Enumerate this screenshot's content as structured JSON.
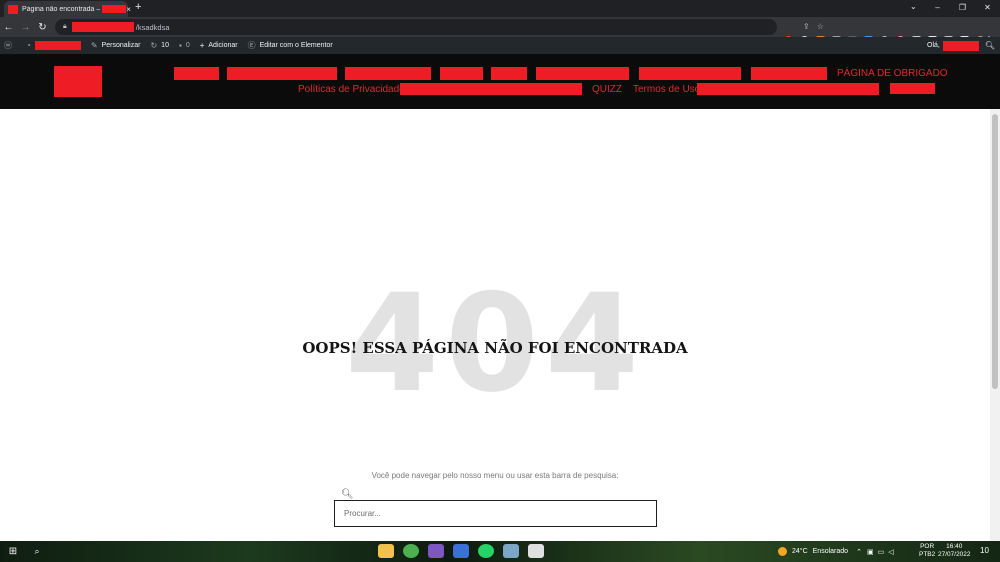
{
  "browser": {
    "tab_title": "Página não encontrada –",
    "tab_close": "×",
    "new_tab": "+",
    "tab_search": "⌄",
    "url_path": "/ksadkdsa",
    "window_controls": {
      "minimize": "–",
      "restore": "❐",
      "close": "✕"
    },
    "menu": "⋮"
  },
  "admin_bar": {
    "customize": "Personalizar",
    "updates_count": "10",
    "comments_count": "0",
    "add_new": "Adicionar",
    "edit_elementor": "Editar com o Elementor",
    "greeting": "Olá,"
  },
  "site_menu": {
    "thank_you": "PÁGINA DE OBRIGADO",
    "privacy": "Políticas de Privacidade",
    "quiz": "QUIZZ",
    "terms": "Termos de Uso"
  },
  "error_page": {
    "code": "404",
    "heading": "OOPS! ESSA PÁGINA NÃO FOI ENCONTRADA",
    "hint": "Você pode navegar pelo nosso menu ou usar esta barra de pesquisa:",
    "search_placeholder": "Procurar..."
  },
  "taskbar": {
    "temperature": "24°C",
    "weather": "Ensolarado",
    "lang_line1": "POR",
    "lang_line2": "PTB2",
    "time": "16:40",
    "date": "27/07/2022",
    "notifications": "10"
  },
  "colors": {
    "accent_red": "#e3282c",
    "redaction": "#ee1c25",
    "header_bg": "#0b0b0b",
    "admin_bar_bg": "#23282d"
  }
}
